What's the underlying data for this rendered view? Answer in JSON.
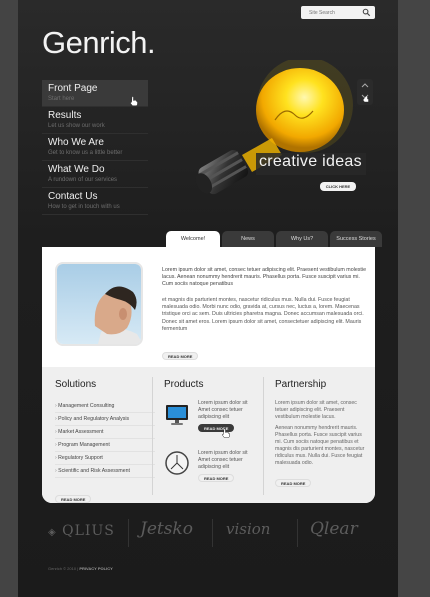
{
  "search": {
    "placeholder": "Site Search"
  },
  "logo": "Genrich.",
  "nav": [
    {
      "title": "Front Page",
      "sub": "Start here"
    },
    {
      "title": "Results",
      "sub": "Let us show our work"
    },
    {
      "title": "Who We Are",
      "sub": "Get to know us a little better"
    },
    {
      "title": "What We Do",
      "sub": "A rundown of our services"
    },
    {
      "title": "Contact Us",
      "sub": "How to get in touch with us"
    }
  ],
  "hero": {
    "tagline": "creative ideas",
    "button": "CLICK HERE"
  },
  "tabs": [
    "Welcome!",
    "News",
    "Why Us?",
    "Success Stories"
  ],
  "welcome": {
    "p1": "Lorem ipsum dolor sit amet, consec tetuer adipiscing elit. Praesent vestibulum molestie lacus. Aenean nonummy hendrerit mauris. Phasellus porta. Fusce suscipit varius mi. Cum sociis natoque penatibus",
    "p2": "et magnis dis parturient montes, nascetur ridiculus mus. Nulla dui. Fusce feugiat malesuada odio. Morbi nunc odio, gravida at, cursus nec, luctus a, lorem. Maecenas tristique orci ac sem. Duis ultricies pharetra magna. Donec accumsan malesuada orci. Donec sit amet eros. Lorem ipsum dolor sit amet, consectetuer adipiscing elit. Mauris fermentum",
    "read_more": "READ MORE"
  },
  "solutions": {
    "title": "Solutions",
    "items": [
      "Management Consulting",
      "Policy and Regulatory Analysis",
      "Market Assessment",
      "Program Management",
      "Regulatory Support",
      "Scientific and Risk Assessment"
    ],
    "read_more": "READ MORE"
  },
  "products": {
    "title": "Products",
    "p1": "Lorem ipsum dolor sit Amet consec tetuer adipiscing elit",
    "p2": "Lorem ipsum dolor sit Amet consec tetuer adipiscing elit",
    "read_more_1": "READ MORE",
    "read_more_2": "READ MORE"
  },
  "partnership": {
    "title": "Partnership",
    "p1": "Lorem ipsum dolor sit amet, consec tetuer adipiscing elit. Praesent vestibulum molestie lacus.",
    "p2": "Aenean nonummy hendrerit mauris. Phasellus porta. Fusce suscipit varius mi. Cum sociis natoque penatibus et magnis dis parturient montes, nascetur ridiculus mus. Nulla dui. Fusce feugiat malesuada odio.",
    "read_more": "READ MORE"
  },
  "brands": [
    "QLIUS",
    "Jetsko",
    "vision",
    "Qlear"
  ],
  "footer": {
    "copyright": "Genrich © 2010 |",
    "privacy": "PRIVACY POLICY"
  }
}
